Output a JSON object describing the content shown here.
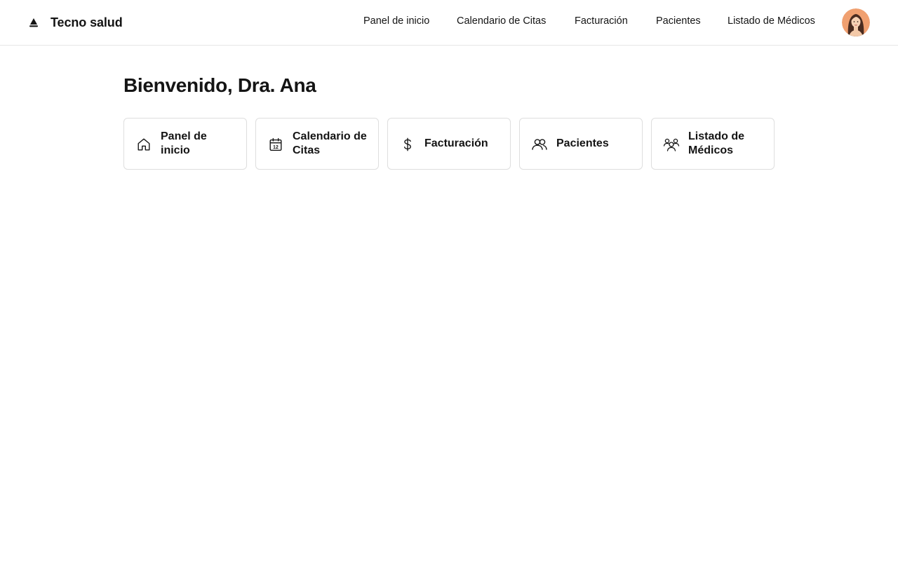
{
  "header": {
    "brand_name": "Tecno salud",
    "brand_icon": "triangle-logo-icon",
    "nav": [
      {
        "label": "Panel de inicio"
      },
      {
        "label": "Calendario de Citas"
      },
      {
        "label": "Facturación"
      },
      {
        "label": "Pacientes"
      },
      {
        "label": "Listado de Médicos"
      }
    ],
    "avatar_icon": "user-avatar"
  },
  "main": {
    "greeting": "Bienvenido, Dra. Ana",
    "cards": [
      {
        "label": "Panel de inicio",
        "icon": "home-icon"
      },
      {
        "label": "Calendario de Citas",
        "icon": "calendar-icon",
        "icon_text": "12"
      },
      {
        "label": "Facturación",
        "icon": "dollar-icon"
      },
      {
        "label": "Pacientes",
        "icon": "users-icon"
      },
      {
        "label": "Listado de Médicos",
        "icon": "doctors-group-icon"
      }
    ]
  },
  "colors": {
    "text": "#141414",
    "border": "#dedede",
    "avatar_bg": "#f0a070"
  }
}
